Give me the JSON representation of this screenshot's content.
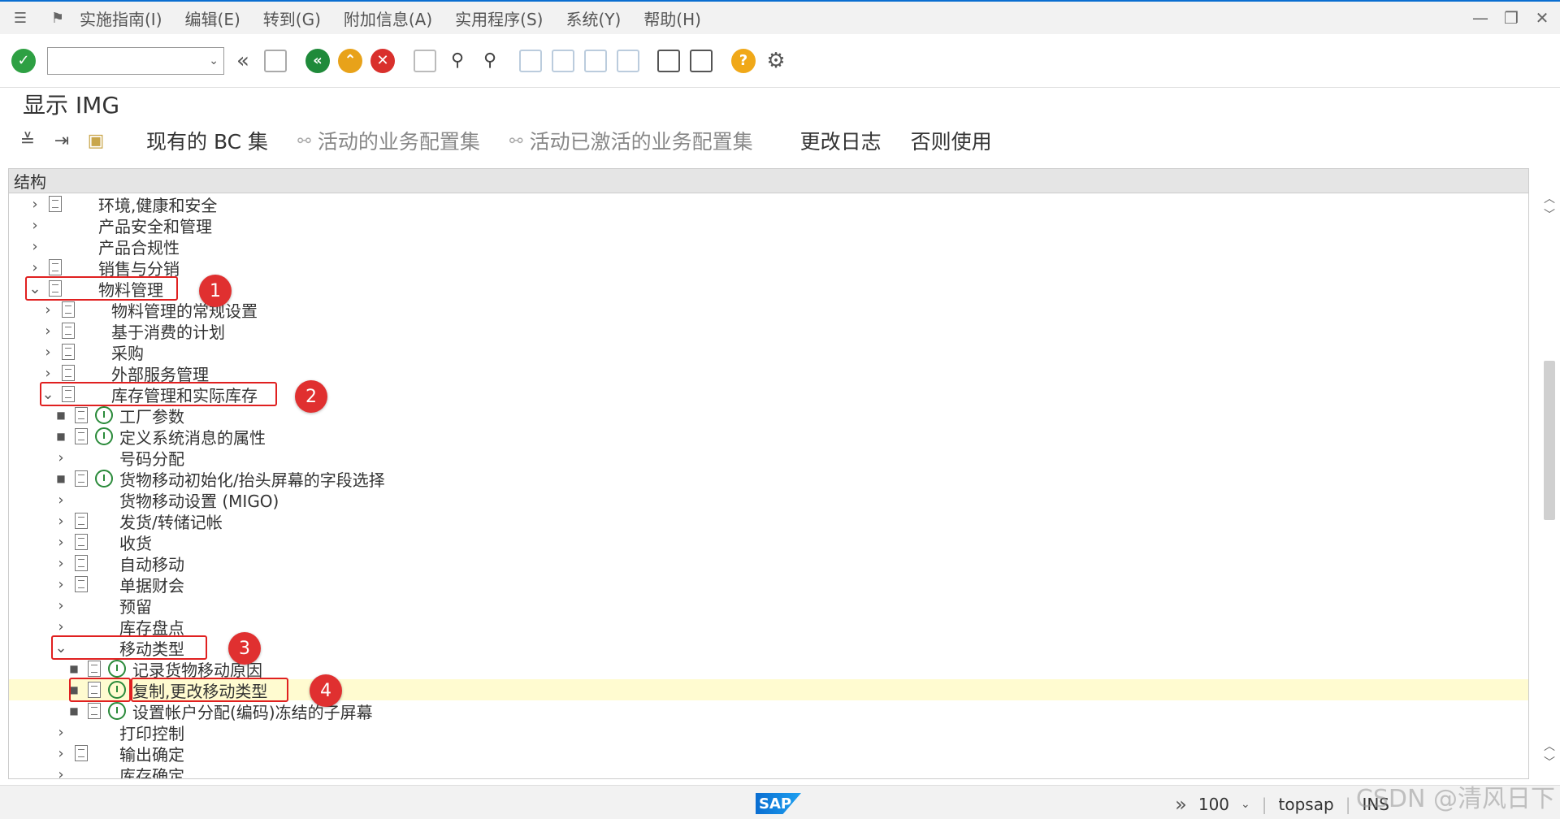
{
  "menubar": {
    "items": [
      "实施指南(I)",
      "编辑(E)",
      "转到(G)",
      "附加信息(A)",
      "实用程序(S)",
      "系统(Y)",
      "帮助(H)"
    ]
  },
  "toolbar": {
    "command_field_value": ""
  },
  "page": {
    "title": "显示 IMG"
  },
  "app_toolbar": {
    "buttons": [
      "现有的 BC 集",
      "活动的业务配置集",
      "活动已激活的业务配置集",
      "更改日志",
      "否则使用"
    ]
  },
  "tree": {
    "header": "结构",
    "rows": [
      {
        "label": "环境,健康和安全"
      },
      {
        "label": "产品安全和管理"
      },
      {
        "label": "产品合规性"
      },
      {
        "label": "销售与分销"
      },
      {
        "label": "物料管理"
      },
      {
        "label": "物料管理的常规设置"
      },
      {
        "label": "基于消费的计划"
      },
      {
        "label": "采购"
      },
      {
        "label": "外部服务管理"
      },
      {
        "label": "库存管理和实际库存"
      },
      {
        "label": "工厂参数"
      },
      {
        "label": "定义系统消息的属性"
      },
      {
        "label": "号码分配"
      },
      {
        "label": "货物移动初始化/抬头屏幕的字段选择"
      },
      {
        "label": "货物移动设置 (MIGO)"
      },
      {
        "label": "发货/转储记帐"
      },
      {
        "label": "收货"
      },
      {
        "label": "自动移动"
      },
      {
        "label": "单据财会"
      },
      {
        "label": "预留"
      },
      {
        "label": "库存盘点"
      },
      {
        "label": "移动类型"
      },
      {
        "label": "记录货物移动原因"
      },
      {
        "label": "复制,更改移动类型"
      },
      {
        "label": "设置帐户分配(编码)冻结的子屏幕"
      },
      {
        "label": "打印控制"
      },
      {
        "label": "输出确定"
      },
      {
        "label": "库存确定"
      }
    ]
  },
  "annotations": [
    "1",
    "2",
    "3",
    "4"
  ],
  "status": {
    "logo": "SAP",
    "zoom": "100",
    "system": "topsap",
    "mode": "INS",
    "watermark": "CSDN @清风日下"
  }
}
